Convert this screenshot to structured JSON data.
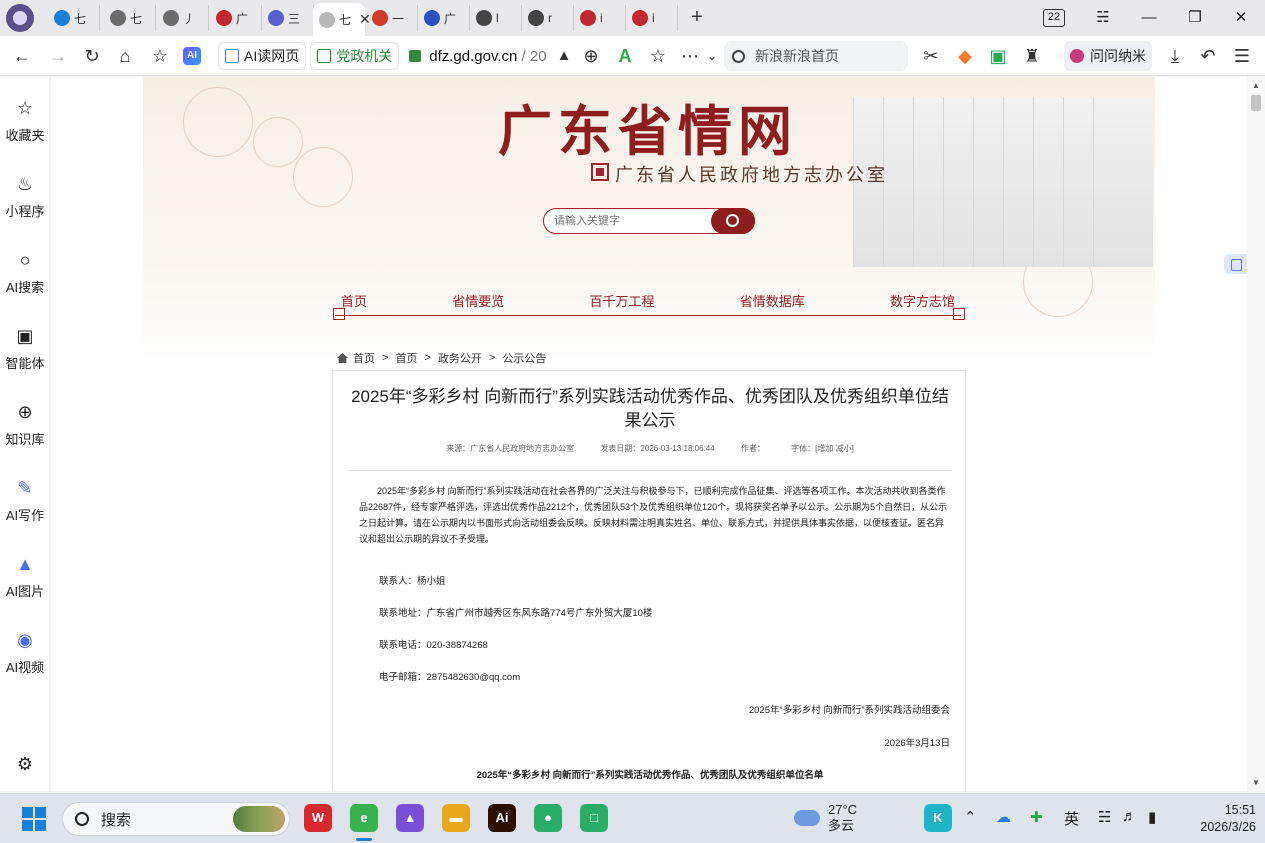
{
  "browser": {
    "tabs": [
      {
        "label": "七",
        "color": "#1a7fd8"
      },
      {
        "label": "七",
        "color": "#6b6b6b"
      },
      {
        "label": "丿",
        "color": "#6b6b6b"
      },
      {
        "label": "广",
        "color": "#c1272d"
      },
      {
        "label": "三",
        "color": "#5a5fd0"
      },
      {
        "label": "七",
        "color": "#b9b9b9"
      },
      {
        "label": "一",
        "color": "#d03a2b"
      },
      {
        "label": "广",
        "color": "#2a52be"
      },
      {
        "label": "l",
        "color": "#444444"
      },
      {
        "label": "r",
        "color": "#444444"
      },
      {
        "label": "i",
        "color": "#c1272d"
      },
      {
        "label": "i",
        "color": "#c1272d"
      }
    ],
    "tab_count": "22",
    "read_mode_label": "AI读网页",
    "gov_label": "党政机关",
    "url_host": "dfz.gd.gov.cn",
    "url_path": "/ 20",
    "search_placeholder": "新浪新浪首页",
    "wenwen_label": "问问纳米",
    "ai_chip": "AI"
  },
  "sidebar": {
    "items": [
      {
        "label": "收藏夹",
        "icon": "☆"
      },
      {
        "label": "小程序",
        "icon": "♨"
      },
      {
        "label": "AI搜索",
        "icon": "○"
      },
      {
        "label": "智能体",
        "icon": "▣"
      },
      {
        "label": "知识库",
        "icon": "⊕"
      },
      {
        "label": "AI写作",
        "icon": "✎"
      },
      {
        "label": "AI图片",
        "icon": "▲"
      },
      {
        "label": "AI视频",
        "icon": "◉"
      }
    ],
    "settings_icon": "⚙"
  },
  "site": {
    "title": "广东省情网",
    "subtitle": "广东省人民政府地方志办公室",
    "search_placeholder": "请输入关键字",
    "nav": [
      "首页",
      "省情要览",
      "百千万工程",
      "省情数据库",
      "数字方志馆"
    ],
    "breadcrumb": [
      "首页",
      "首页",
      "政务公开",
      "公示公告"
    ],
    "breadcrumb_sep": ">",
    "accent": "#8e1d1d"
  },
  "article": {
    "title": "2025年“多彩乡村 向新而行”系列实践活动优秀作品、优秀团队及优秀组织单位结果公示",
    "source": "来源：广东省人民政府地方志办公室",
    "date": "发表日期：2026-03-13 18:06:44",
    "author": "作者：",
    "font_size": "字体：[增加 减小]",
    "body": "2025年“多彩乡村 向新而行”系列实践活动在社会各界的广泛关注与积极参与下，已顺利完成作品征集、评选等各项工作。本次活动共收到各类作品22687件，经专家严格评选，评选出优秀作品2212个，优秀团队53个及优秀组织单位120个。现将获奖名单予以公示。公示期为5个自然日，从公示之日起计算。请在公示期内以书面形式向活动组委会反映。反映材料需注明真实姓名、单位、联系方式，并提供具体事实依据，以便核查证。匿名异议和超出公示期的异议不予受理。",
    "contact_person": "联系人：杨小姐",
    "contact_address": "联系地址：广东省广州市越秀区东风东路774号广东外贸大厦10楼",
    "contact_phone": "联系电话：020-38874268",
    "contact_email": "电子邮箱：2875482630@qq.com",
    "signature": "2025年“多彩乡村 向新而行”系列实践活动组委会",
    "sign_date": "2026年3月13日",
    "list_title": "2025年“多彩乡村 向新而行”系列实践活动优秀作品、优秀团队及优秀组织单位名单"
  },
  "taskbar": {
    "search_label": "搜索",
    "apps": [
      {
        "name": "wps",
        "label": "W",
        "color": "#d7282f"
      },
      {
        "name": "browser",
        "label": "e",
        "color": "#37b24d"
      },
      {
        "name": "ai-art",
        "label": "▲",
        "color": "#7a4fd8"
      },
      {
        "name": "files",
        "label": "▬",
        "color": "#e9a81c"
      },
      {
        "name": "illustrator",
        "label": "Ai",
        "color": "#2b0e00"
      },
      {
        "name": "wechat",
        "label": "●",
        "color": "#2aae67"
      },
      {
        "name": "wechat-work",
        "label": "□",
        "color": "#2aae67"
      }
    ],
    "temperature": "27°C",
    "weather": "多云",
    "ime": "英",
    "time": "15:51",
    "date": "2026/3/26"
  }
}
